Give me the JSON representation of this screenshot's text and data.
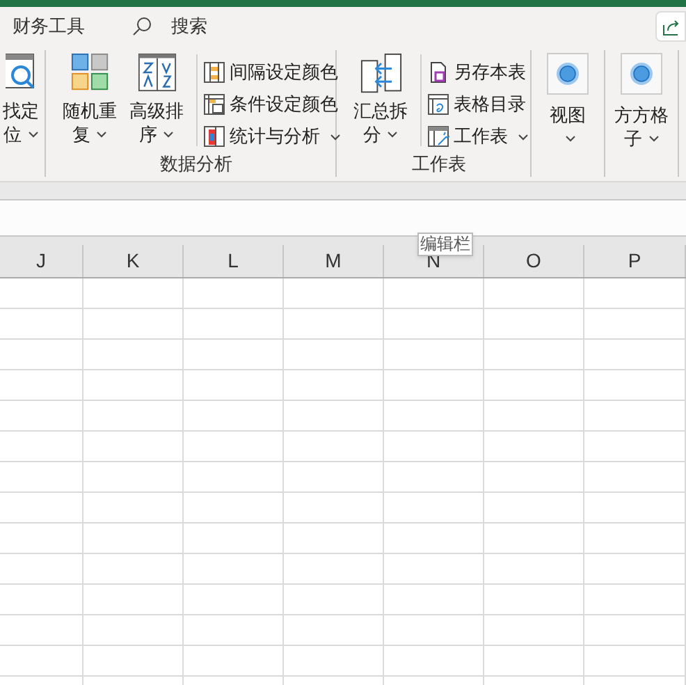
{
  "tabs": [
    {
      "label": "财务工具",
      "selected": false
    }
  ],
  "search": {
    "label": "搜索"
  },
  "ribbon": {
    "groups": [
      {
        "items": [
          {
            "kind": "big",
            "label": "找定",
            "label2": "位",
            "dropdown": true
          }
        ]
      },
      {
        "label": "数据分析",
        "items": [
          {
            "kind": "big",
            "label": "随机重",
            "label2": "复",
            "dropdown": true
          },
          {
            "kind": "big",
            "label": "高级排",
            "label2": "序",
            "dropdown": true
          },
          {
            "kind": "list",
            "entries": [
              {
                "label": "间隔设定颜色",
                "dropdown": false
              },
              {
                "label": "条件设定颜色",
                "dropdown": false
              },
              {
                "label": "统计与分析",
                "dropdown": true
              }
            ]
          }
        ]
      },
      {
        "label": "工作表",
        "items": [
          {
            "kind": "big",
            "label": "汇总拆",
            "label2": "分",
            "dropdown": true
          },
          {
            "kind": "list",
            "entries": [
              {
                "label": "另存本表",
                "dropdown": false
              },
              {
                "label": "表格目录",
                "dropdown": false
              },
              {
                "label": "工作表",
                "dropdown": true
              }
            ]
          }
        ]
      },
      {
        "items": [
          {
            "kind": "framed",
            "label": "视图",
            "dropdown": true
          }
        ]
      },
      {
        "items": [
          {
            "kind": "framed",
            "label": "方方格",
            "label2": "子",
            "dropdown": true
          }
        ]
      }
    ]
  },
  "columns": [
    "J",
    "K",
    "L",
    "M",
    "N",
    "O",
    "P"
  ],
  "tooltip": "编辑栏"
}
